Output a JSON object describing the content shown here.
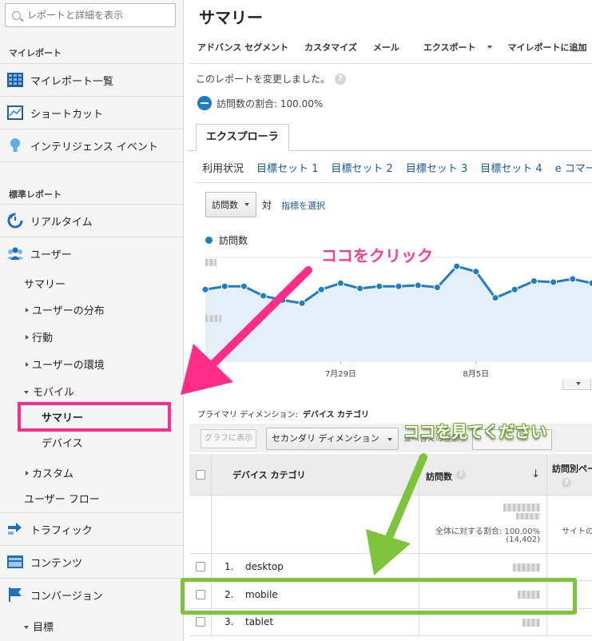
{
  "sidebar": {
    "search_placeholder": "レポートと詳細を表示",
    "my_reports_head": "マイレポート",
    "my_reports_list": "マイレポート一覧",
    "shortcuts": "ショートカット",
    "intelligence": "インテリジェンス イベント",
    "standard_head": "標準レポート",
    "realtime": "リアルタイム",
    "users": "ユーザー",
    "summary": "サマリー",
    "user_dist": "ユーザーの分布",
    "behavior": "行動",
    "user_env": "ユーザーの環境",
    "mobile": "モバイル",
    "mobile_summary": "サマリー",
    "devices": "デバイス",
    "custom": "カスタム",
    "user_flow": "ユーザー フロー",
    "traffic": "トラフィック",
    "content": "コンテンツ",
    "conversions": "コンバージョン",
    "goals": "目標"
  },
  "main": {
    "title": "サマリー",
    "toolbar": {
      "advanced_segment": "アドバンス セグメント",
      "customize": "カスタマイズ",
      "email": "メール",
      "export": "エクスポート",
      "add_dashboard": "マイレポートに追加"
    },
    "modified_msg": "このレポートを変更しました。",
    "help_mark": "?",
    "visits_pct": "訪問数の割合: 100.00%",
    "explorer_tab": "エクスプローラ",
    "subtabs": [
      "利用状況",
      "目標セット 1",
      "目標セット 2",
      "目標セット 3",
      "目標セット 4",
      "e コマー"
    ],
    "metric_select": "訪問数",
    "vs": "対",
    "choose_metric": "指標を選択",
    "legend": "訪問数",
    "x_labels": [
      "7月29日",
      "8月5日"
    ],
    "primary_dim_label": "プライマリ ディメンション:",
    "primary_dim_value": "デバイス カテゴリ",
    "graph_btn": "グラフに表示",
    "secondary_dim": "セカンダリ ディメンション",
    "sort_type_ghost": "並べ替えの種類",
    "table": {
      "col_dim": "デバイス カテゴリ",
      "col_visits": "訪問数",
      "col_pv": "訪問別ペー",
      "pct_of_total": "全体に対する割合: 100.00%",
      "total": "(14,402)",
      "site_avg": "サイトの",
      "rows": [
        {
          "num": "1.",
          "label": "desktop"
        },
        {
          "num": "2.",
          "label": "mobile"
        },
        {
          "num": "3.",
          "label": "tablet"
        }
      ]
    }
  },
  "annotations": {
    "click_here": "ココをクリック",
    "look_here": "ココを見てください"
  },
  "chart_data": {
    "type": "line",
    "series": [
      {
        "name": "訪問数",
        "values": [
          0.68,
          0.71,
          0.71,
          0.62,
          0.58,
          0.55,
          0.68,
          0.74,
          0.69,
          0.71,
          0.71,
          0.72,
          0.7,
          0.9,
          0.85,
          0.6,
          0.68,
          0.76,
          0.75,
          0.78,
          0.74
        ]
      }
    ],
    "x_tick_labels": [
      "7月29日",
      "8月5日"
    ],
    "ylim": [
      0,
      1
    ],
    "grid": true,
    "colors": {
      "line": "#1d7dc6",
      "fill": "#e4f0f9"
    }
  }
}
